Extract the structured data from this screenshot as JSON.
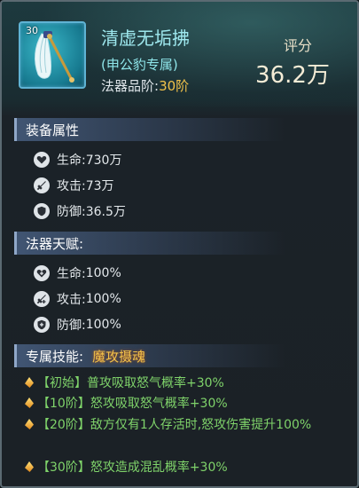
{
  "item": {
    "level": "30",
    "name": "清虚无垢拂",
    "owner": "(申公豹专属)",
    "grade_label": "法器品阶:",
    "grade_value": "30阶"
  },
  "score": {
    "label": "评分",
    "value": "36.2万"
  },
  "equip_attrs": {
    "title": "装备属性",
    "rows": [
      {
        "icon": "heart-icon",
        "label": "生命:",
        "value": "730万"
      },
      {
        "icon": "sword-icon",
        "label": "攻击:",
        "value": "73万"
      },
      {
        "icon": "shield-icon",
        "label": "防御:",
        "value": "36.5万"
      }
    ]
  },
  "talent": {
    "title": "法器天赋:",
    "rows": [
      {
        "icon": "heart-plus-icon",
        "label": "生命:",
        "value": "100%"
      },
      {
        "icon": "sword-plus-icon",
        "label": "攻击:",
        "value": "100%"
      },
      {
        "icon": "shield-plus-icon",
        "label": "防御:",
        "value": "100%"
      }
    ]
  },
  "skill": {
    "title": "专属技能:",
    "name": "魔攻摄魂",
    "rows": [
      {
        "tier": "【初始】",
        "text": "普攻吸取怒气概率+30%"
      },
      {
        "tier": "【10阶】",
        "text": "怒攻吸取怒气概率+30%"
      },
      {
        "tier": "【20阶】",
        "text": "敌方仅有1人存活时,怒攻伤害提升100%"
      },
      {
        "tier": "【30阶】",
        "text": "怒攻造成混乱概率+30%"
      }
    ]
  },
  "colors": {
    "accent": "#9ee8ee",
    "gold": "#f1c24a",
    "green": "#7fd36a"
  }
}
